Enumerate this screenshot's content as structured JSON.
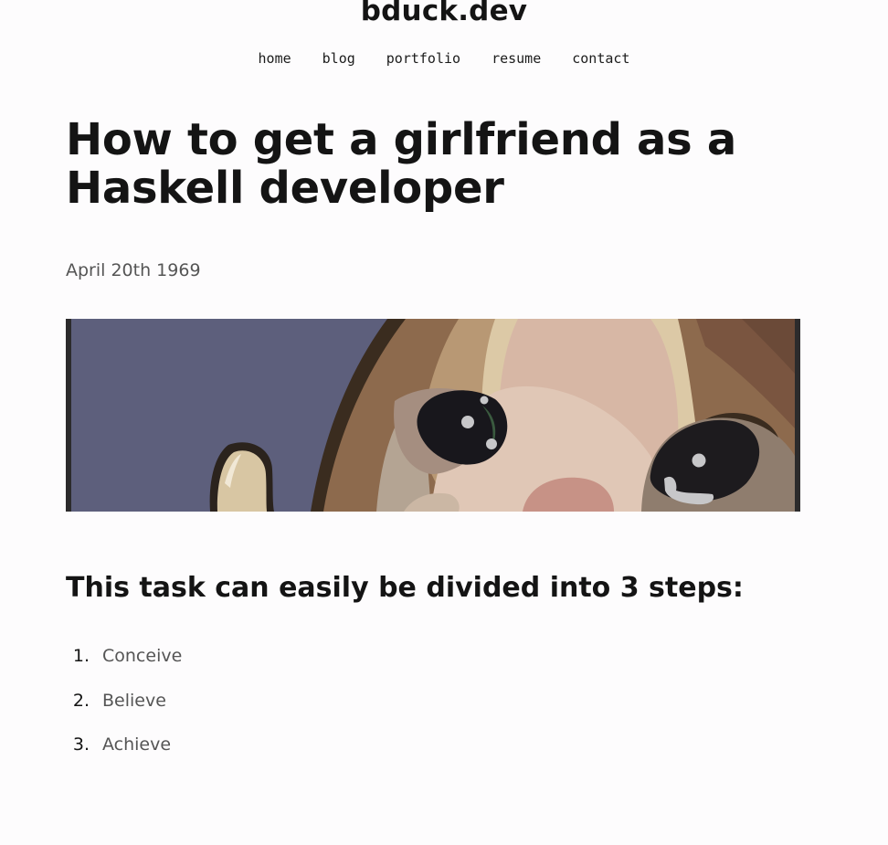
{
  "site": {
    "title": "bduck.dev"
  },
  "nav": {
    "items": [
      {
        "label": "home"
      },
      {
        "label": "blog"
      },
      {
        "label": "portfolio"
      },
      {
        "label": "resume"
      },
      {
        "label": "contact"
      }
    ]
  },
  "post": {
    "title": "How to get a girlfriend as a Haskell developer",
    "date": "April 20th 1969",
    "steps_heading": "This task can easily be divided into 3 steps:",
    "steps": [
      {
        "number": "1.",
        "text": "Conceive"
      },
      {
        "number": "2.",
        "text": "Believe"
      },
      {
        "number": "3.",
        "text": "Achieve"
      }
    ]
  },
  "colors": {
    "background": "#fdfcfd",
    "heading": "#141414",
    "muted_text": "#555555"
  }
}
